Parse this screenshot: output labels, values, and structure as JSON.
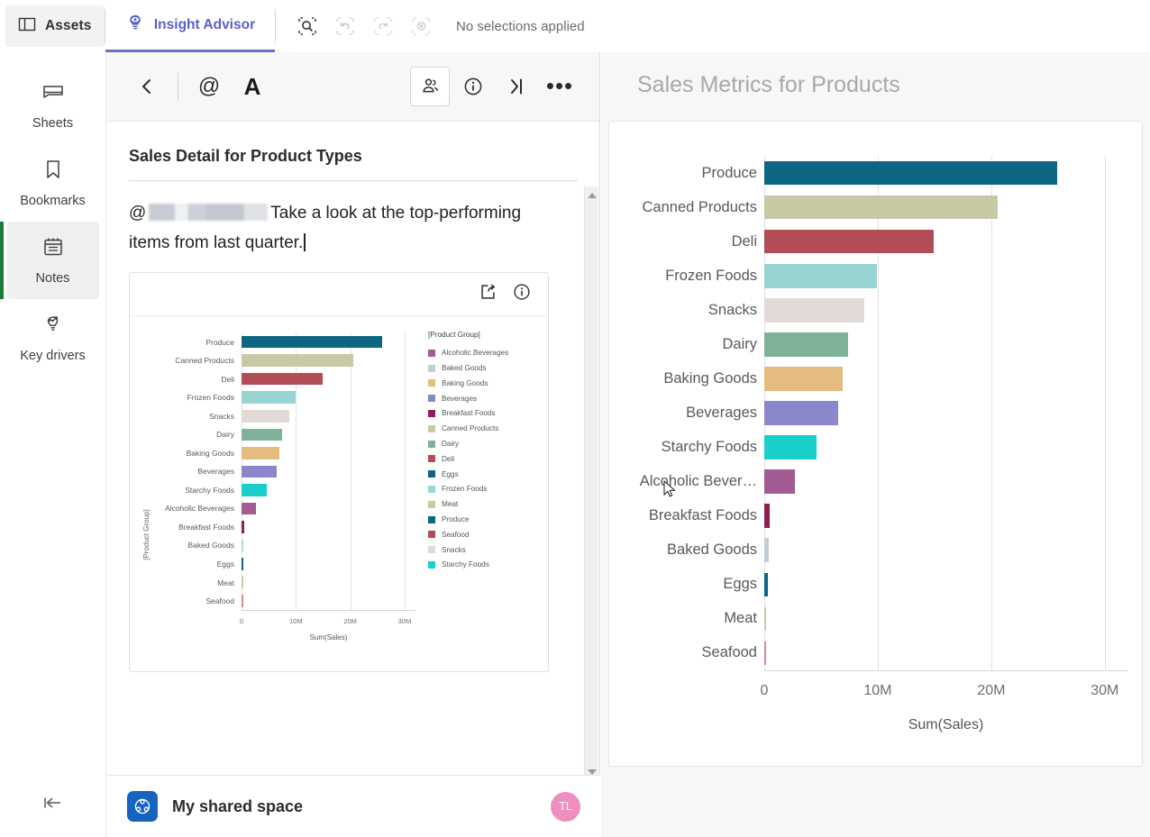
{
  "topbar": {
    "assets_label": "Assets",
    "assets_icon": "panel-icon",
    "insight_advisor_label": "Insight Advisor",
    "insight_advisor_icon": "insight-advisor-icon",
    "selection_search_icon": "selection-search-icon",
    "undo_icon": "undo-selection-icon",
    "redo_icon": "redo-selection-icon",
    "clear_icon": "clear-selections-icon",
    "no_selections_text": "No selections applied",
    "accent": "#595fc7"
  },
  "sidebar": {
    "items": [
      {
        "label": "Sheets",
        "icon": "sheets-icon",
        "active": false
      },
      {
        "label": "Bookmarks",
        "icon": "bookmark-icon",
        "active": false
      },
      {
        "label": "Notes",
        "icon": "notes-icon",
        "active": true
      },
      {
        "label": "Key drivers",
        "icon": "key-drivers-icon",
        "active": false
      }
    ],
    "active_accent": "#1a7a37",
    "collapse_icon": "collapse-left-icon"
  },
  "note_panel": {
    "toolbar": {
      "back_icon": "chevron-left-icon",
      "mention_icon": "at-mention-icon",
      "format_icon": "text-format-icon",
      "share_people_icon": "share-people-icon",
      "info_icon": "info-icon",
      "collapse_right_icon": "collapse-right-icon",
      "more_icon": "more-options-icon"
    },
    "note_title": "Sales Detail for Product Types",
    "note_text_redacted_mention": "@",
    "note_text": "Take a look at the top-performing items from last quarter.",
    "embed_card": {
      "share_icon": "share-external-icon",
      "info_icon": "info-icon"
    },
    "scrollbar": {
      "up_icon": "scroll-up-arrow",
      "down_icon": "scroll-down-arrow"
    }
  },
  "space_bar": {
    "space_icon": "shared-space-icon",
    "space_name": "My shared space",
    "avatar_initials": "TL",
    "avatar_color": "#ef8fc0"
  },
  "stage": {
    "title": "Sales Metrics for Products"
  },
  "chart_data": [
    {
      "id": "main-chart",
      "type": "bar",
      "orientation": "horizontal",
      "title": "Sales Metrics for Products",
      "xlabel": "Sum(Sales)",
      "ylabel": "",
      "xlim": [
        0,
        32000000
      ],
      "xticks": [
        0,
        10000000,
        20000000,
        30000000
      ],
      "xtick_labels": [
        "0",
        "10M",
        "20M",
        "30M"
      ],
      "grid": true,
      "legend": false,
      "categories": [
        "Produce",
        "Canned Products",
        "Deli",
        "Frozen Foods",
        "Snacks",
        "Dairy",
        "Baking Goods",
        "Beverages",
        "Starchy Foods",
        "Alcoholic Bever…",
        "Breakfast Foods",
        "Baked Goods",
        "Eggs",
        "Meat",
        "Seafood"
      ],
      "values": [
        25800000,
        20600000,
        14900000,
        9900000,
        8800000,
        7400000,
        6900000,
        6500000,
        4600000,
        2700000,
        450000,
        400000,
        350000,
        120000,
        90000
      ],
      "colors": [
        "#0d6682",
        "#c9c8a4",
        "#b24d57",
        "#97d4d2",
        "#e2dad6",
        "#7db198",
        "#e4bc7f",
        "#8a87cb",
        "#18cfc9",
        "#a35b94",
        "#8e1e52",
        "#c3cdd8",
        "#0d6682",
        "#cdc9a3",
        "#d08e91"
      ]
    },
    {
      "id": "embedded-chart",
      "type": "bar",
      "orientation": "horizontal",
      "title": "",
      "xlabel": "Sum(Sales)",
      "ylabel": "[Product Group]",
      "xlim": [
        0,
        32000000
      ],
      "xticks": [
        0,
        10000000,
        20000000,
        30000000
      ],
      "xtick_labels": [
        "0",
        "10M",
        "20M",
        "30M"
      ],
      "grid": true,
      "legend": true,
      "legend_position": "right",
      "legend_title": "[Product Group]",
      "categories": [
        "Produce",
        "Canned Products",
        "Deli",
        "Frozen Foods",
        "Snacks",
        "Dairy",
        "Baking Goods",
        "Beverages",
        "Starchy Foods",
        "Alcoholic Beverages",
        "Breakfast Foods",
        "Baked Goods",
        "Eggs",
        "Meat",
        "Seafood"
      ],
      "values": [
        25800000,
        20600000,
        14900000,
        9900000,
        8800000,
        7400000,
        6900000,
        6500000,
        4600000,
        2700000,
        450000,
        400000,
        350000,
        120000,
        90000
      ],
      "colors": [
        "#0d6682",
        "#c9c8a4",
        "#b24d57",
        "#97d4d2",
        "#e2dad6",
        "#7db198",
        "#e4bc7f",
        "#8a87cb",
        "#18cfc9",
        "#a35b94",
        "#8e1e52",
        "#c3cdd8",
        "#0d6682",
        "#cdc9a3",
        "#d08e91"
      ],
      "legend_entries": [
        {
          "label": "Alcoholic Beverages",
          "color": "#a35b94"
        },
        {
          "label": "Baked Goods",
          "color": "#c3cdd8"
        },
        {
          "label": "Baking Goods",
          "color": "#e4bc7f"
        },
        {
          "label": "Beverages",
          "color": "#8a87cb"
        },
        {
          "label": "Breakfast Foods",
          "color": "#8e1e52"
        },
        {
          "label": "Canned Products",
          "color": "#c9c8a4"
        },
        {
          "label": "Dairy",
          "color": "#7db198"
        },
        {
          "label": "Deli",
          "color": "#b24d57"
        },
        {
          "label": "Eggs",
          "color": "#0d6682"
        },
        {
          "label": "Frozen Foods",
          "color": "#97d4d2"
        },
        {
          "label": "Meat",
          "color": "#cdc9a3"
        },
        {
          "label": "Produce",
          "color": "#0d6682"
        },
        {
          "label": "Seafood",
          "color": "#b24d57"
        },
        {
          "label": "Snacks",
          "color": "#e2dad6"
        },
        {
          "label": "Starchy Foods",
          "color": "#18cfc9"
        }
      ]
    }
  ]
}
